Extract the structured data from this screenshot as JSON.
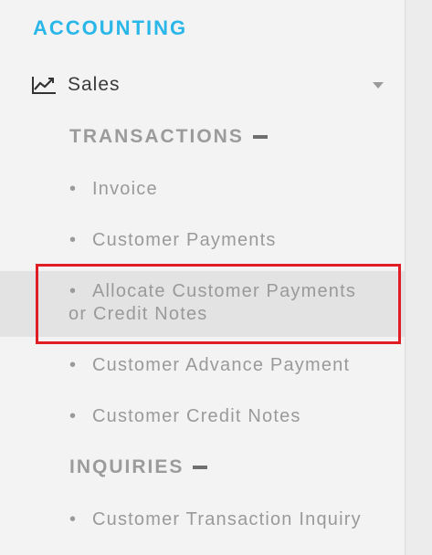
{
  "section": {
    "title": "ACCOUNTING"
  },
  "module": {
    "label": "Sales",
    "icon": "line-chart-icon",
    "caret_icon": "caret-down-icon"
  },
  "groups": [
    {
      "title": "TRANSACTIONS",
      "items": [
        {
          "label": "Invoice"
        },
        {
          "label": "Customer Payments"
        },
        {
          "label": "Allocate Customer Payments or Credit Notes",
          "line1": "Allocate Customer Payments",
          "line2": "or Credit Notes",
          "active": true
        },
        {
          "label": "Customer Advance Payment"
        },
        {
          "label": "Customer Credit Notes"
        }
      ]
    },
    {
      "title": "INQUIRIES",
      "items": [
        {
          "label": "Customer Transaction Inquiry"
        }
      ]
    }
  ],
  "bullet": "•",
  "colors": {
    "accent": "#29b6e8",
    "highlight_border": "#e01d25",
    "active_bg": "#e3e3e3"
  }
}
